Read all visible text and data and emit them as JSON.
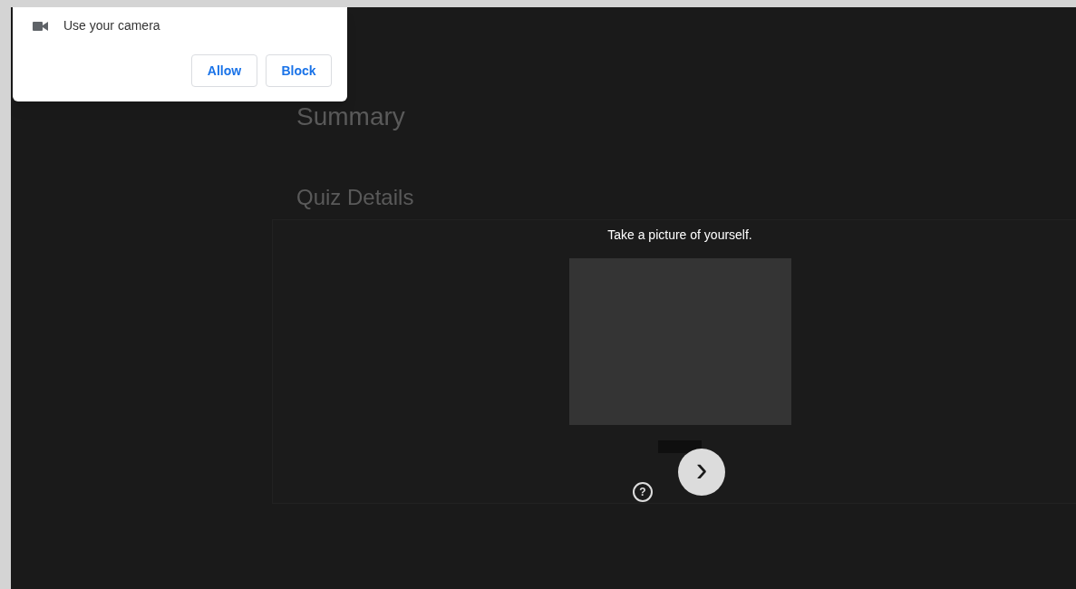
{
  "permission_prompt": {
    "text": "Use your camera",
    "buttons": [
      "Allow",
      "Block"
    ]
  },
  "page": {
    "headings": [
      "Summary",
      "Quiz Details"
    ]
  },
  "camera_dialog": {
    "title": "Take a picture of yourself.",
    "next_label": "›",
    "help_label": "?"
  }
}
